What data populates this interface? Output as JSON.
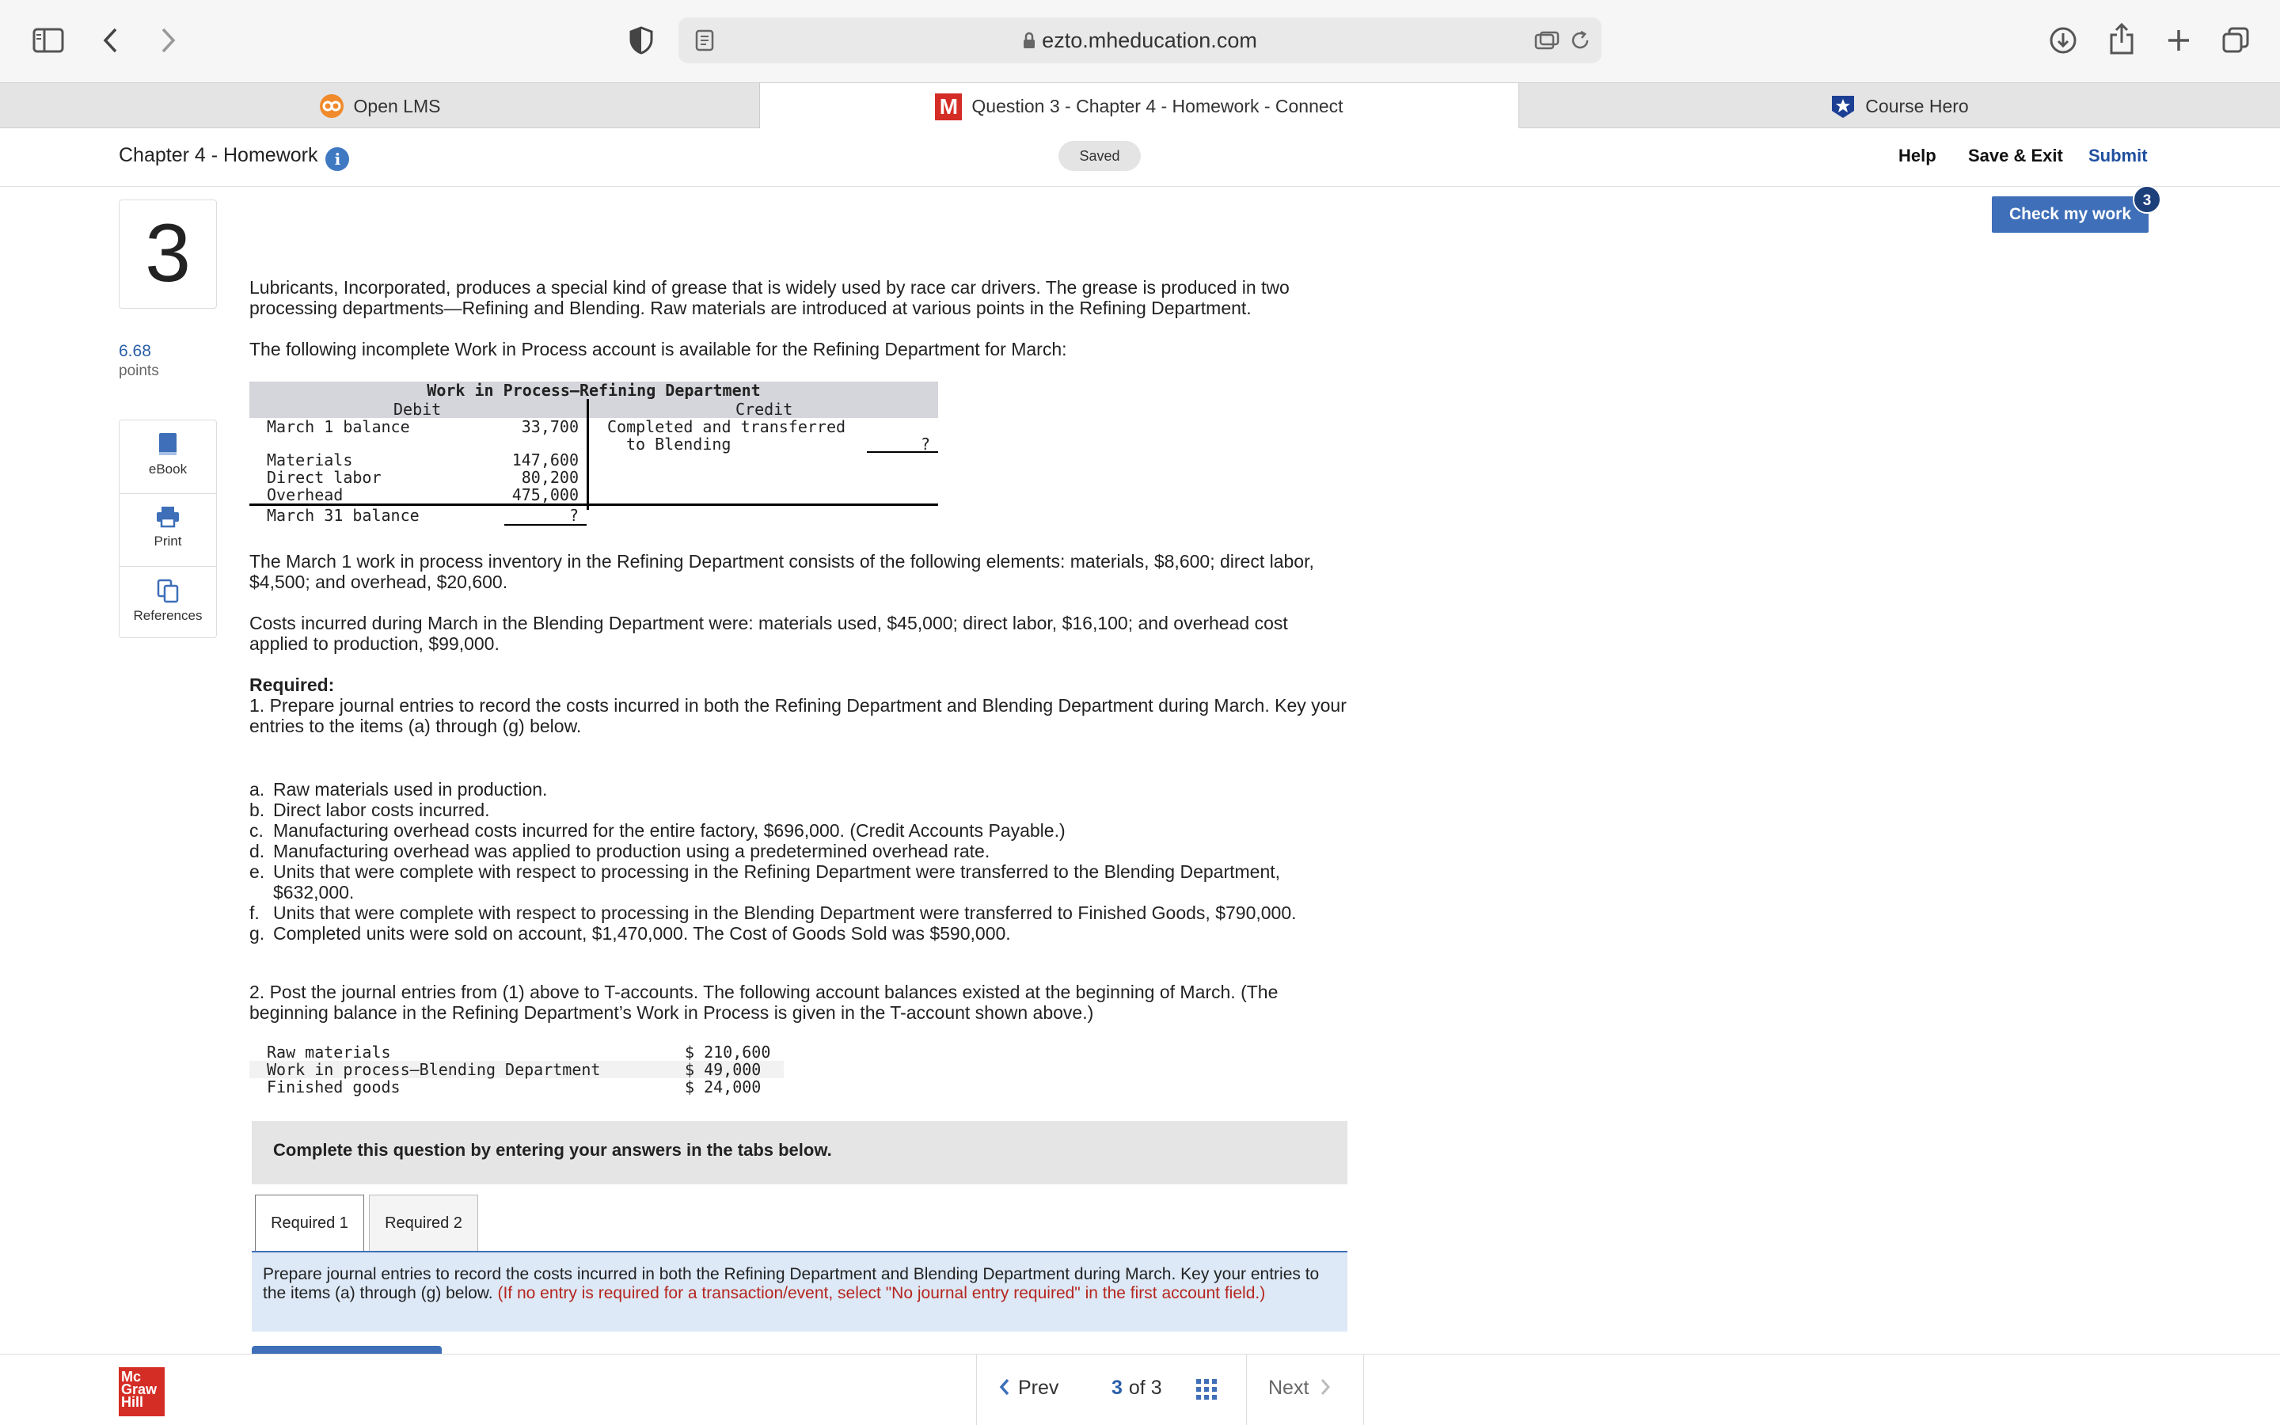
{
  "browser": {
    "url": "ezto.mheducation.com",
    "tabs": [
      {
        "label": "Open LMS",
        "icon": "open-lms-icon"
      },
      {
        "label": "Question 3 - Chapter 4 - Homework - Connect",
        "icon": "mcgraw-m-icon"
      },
      {
        "label": "Course Hero",
        "icon": "course-hero-icon"
      }
    ]
  },
  "header": {
    "assignment_title": "Chapter 4 - Homework",
    "saved": "Saved",
    "help": "Help",
    "save_exit": "Save & Exit",
    "submit": "Submit"
  },
  "question": {
    "number": "3",
    "points_value": "6.68",
    "points_label": "points",
    "check_label": "Check my work",
    "check_badge": "3"
  },
  "tools": {
    "ebook": "eBook",
    "print": "Print",
    "references": "References"
  },
  "content": {
    "intro": "Lubricants, Incorporated, produces a special kind of grease that is widely used by race car drivers. The grease is produced in two processing departments—Refining and Blending. Raw materials are introduced at various points in the Refining Department.",
    "wip_intro": "The following incomplete Work in Process account is available for the Refining Department for March:",
    "taccount": {
      "title": "Work in Process—Refining Department",
      "debit_label": "Debit",
      "credit_label": "Credit",
      "debit_rows": [
        {
          "label": "March 1 balance",
          "value": "33,700"
        },
        {
          "label": "Materials",
          "value": "147,600"
        },
        {
          "label": "Direct labor",
          "value": "80,200"
        },
        {
          "label": "Overhead",
          "value": "475,000"
        },
        {
          "label": "March 31 balance",
          "value": "?"
        }
      ],
      "credit_line1": "Completed and transferred",
      "credit_line2": "to Blending",
      "credit_value": "?"
    },
    "para_march1": "The March 1 work in process inventory in the Refining Department consists of the following elements: materials, $8,600; direct labor, $4,500; and overhead, $20,600.",
    "para_blending": "Costs incurred during March in the Blending Department were: materials used, $45,000; direct labor, $16,100; and overhead cost applied to production, $99,000.",
    "required_heading": "Required:",
    "required_1": "1. Prepare journal entries to record the costs incurred in both the Refining Department and Blending Department during March. Key your entries to the items (a) through (g) below.",
    "items": [
      {
        "letter": "a.",
        "text": "Raw materials used in production."
      },
      {
        "letter": "b.",
        "text": "Direct labor costs incurred."
      },
      {
        "letter": "c.",
        "text": "Manufacturing overhead costs incurred for the entire factory, $696,000. (Credit Accounts Payable.)"
      },
      {
        "letter": "d.",
        "text": "Manufacturing overhead was applied to production using a predetermined overhead rate."
      },
      {
        "letter": "e.",
        "text": "Units that were complete with respect to processing in the Refining Department were transferred to the Blending Department, $632,000."
      },
      {
        "letter": "f.",
        "text": "Units that were complete with respect to processing in the Blending Department were transferred to Finished Goods, $790,000."
      },
      {
        "letter": "g.",
        "text": "Completed units were sold on account, $1,470,000. The Cost of Goods Sold was $590,000."
      }
    ],
    "required_2": "2. Post the journal entries from (1) above to T-accounts. The following account balances existed at the beginning of March. (The beginning balance in the Refining Department’s Work in Process is given in the T-account shown above.)",
    "balances": [
      {
        "label": "Raw materials",
        "value": "$ 210,600"
      },
      {
        "label": "Work in process—Blending Department",
        "value": "$ 49,000"
      },
      {
        "label": "Finished goods",
        "value": "$ 24,000"
      }
    ],
    "banner": "Complete this question by entering your answers in the tabs below.",
    "req_tabs": [
      "Required 1",
      "Required 2"
    ],
    "instruction": "Prepare journal entries to record the costs incurred in both the Refining Department and Blending Department during March. Key your entries to the items (a) through (g) below.",
    "instruction_red": "(If no entry is required for a transaction/event, select \"No journal entry required\" in the first account field.)"
  },
  "footer": {
    "logo": [
      "Mc",
      "Graw",
      "Hill"
    ],
    "prev": "Prev",
    "current": "3",
    "of_label": "of 3",
    "next": "Next"
  },
  "colors": {
    "brand_blue": "#3e6fb8",
    "mh_red": "#d42d25",
    "instruction_red": "#b5261e"
  }
}
